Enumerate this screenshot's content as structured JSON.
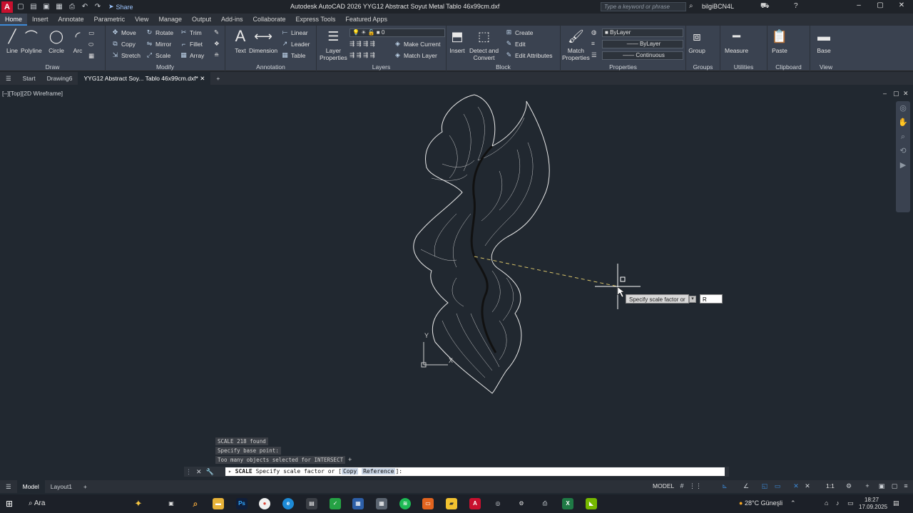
{
  "titlebar": {
    "app_logo": "A",
    "share": "Share",
    "title": "Autodesk AutoCAD 2026    YYG12 Abstract Soyut Metal Tablo 46x99cm.dxf",
    "search_placeholder": "Type a keyword or phrase",
    "user": "bilgiBCN4L"
  },
  "ribbon_tabs": [
    "Home",
    "Insert",
    "Annotate",
    "Parametric",
    "View",
    "Manage",
    "Output",
    "Add-ins",
    "Collaborate",
    "Express Tools",
    "Featured Apps"
  ],
  "draw": {
    "title": "Draw",
    "line": "Line",
    "polyline": "Polyline",
    "circle": "Circle",
    "arc": "Arc"
  },
  "modify": {
    "title": "Modify",
    "move": "Move",
    "rotate": "Rotate",
    "trim": "Trim",
    "copy": "Copy",
    "mirror": "Mirror",
    "fillet": "Fillet",
    "stretch": "Stretch",
    "scale": "Scale",
    "array": "Array"
  },
  "annotation": {
    "title": "Annotation",
    "text": "Text",
    "dimension": "Dimension",
    "linear": "Linear",
    "leader": "Leader",
    "table": "Table"
  },
  "layers": {
    "title": "Layers",
    "layer_properties_1": "Layer",
    "layer_properties_2": "Properties",
    "current_layer": "0",
    "make_current": "Make Current",
    "match_layer": "Match Layer"
  },
  "block": {
    "title": "Block",
    "insert": "Insert",
    "detect_1": "Detect and",
    "detect_2": "Convert",
    "create": "Create",
    "edit": "Edit",
    "edit_attributes": "Edit Attributes"
  },
  "properties": {
    "title": "Properties",
    "match_1": "Match",
    "match_2": "Properties",
    "color": "ByLayer",
    "lineweight": "ByLayer",
    "linetype": "Continuous"
  },
  "groups": {
    "title": "Groups",
    "group": "Group"
  },
  "utilities": {
    "title": "Utilities",
    "measure": "Measure"
  },
  "clipboard": {
    "title": "Clipboard",
    "paste": "Paste"
  },
  "view_panel": {
    "title": "View",
    "base": "Base"
  },
  "file_tabs": [
    "Start",
    "Drawing6",
    "YYG12 Abstract Soy... Tablo 46x99cm.dxf*"
  ],
  "viewport": {
    "label": "[–][Top][2D Wireframe]"
  },
  "tooltip": {
    "prompt": "Specify scale factor or",
    "input": "R"
  },
  "command_history": [
    "SCALE 218 found",
    "Specify base point:",
    "Too many objects selected for INTERSECT"
  ],
  "command_line": {
    "command": "SCALE",
    "prompt": "Specify scale factor or [",
    "opt1": "Copy",
    "opt2": "Reference",
    "end": "]:"
  },
  "layout_tabs": [
    "Model",
    "Layout1"
  ],
  "status": {
    "model": "MODEL",
    "scale": "1:1"
  },
  "taskbar": {
    "search": "Ara",
    "weather": "28°C  Güneşli",
    "time": "18:27",
    "date": "17.09.2025"
  }
}
